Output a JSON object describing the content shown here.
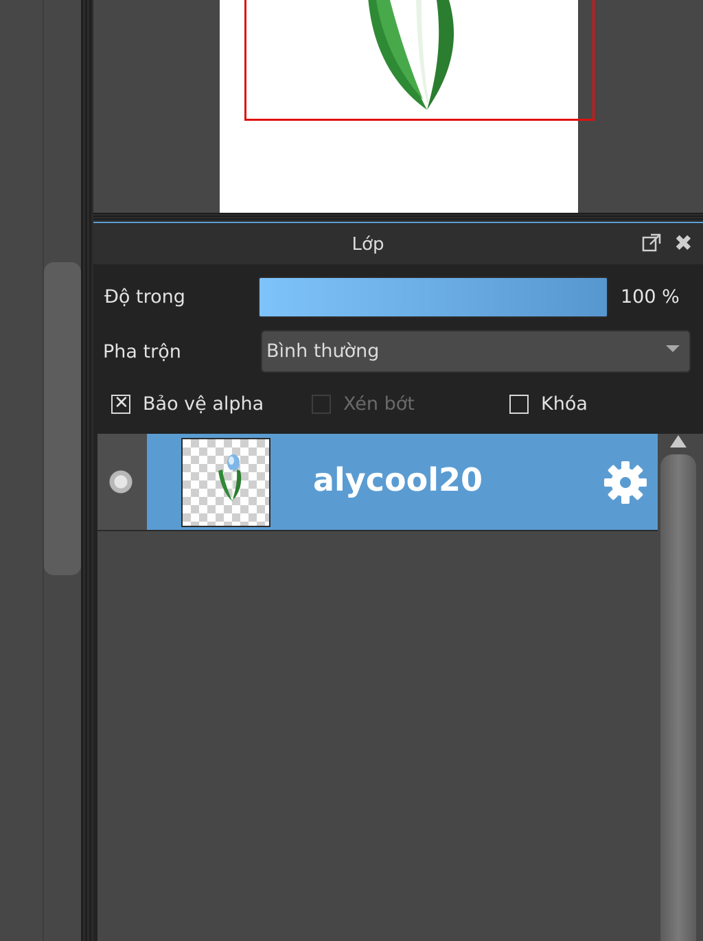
{
  "panel": {
    "title": "Lớp",
    "popout_icon": "popout-icon",
    "close_icon": "close-icon"
  },
  "opacity": {
    "label": "Độ trong",
    "value": "100 %",
    "level": 1.0
  },
  "blend": {
    "label": "Pha trộn",
    "value": "Bình thường"
  },
  "checkboxes": {
    "alpha": {
      "label": "Bảo vệ alpha",
      "checked": true
    },
    "clip": {
      "label": "Xén bớt",
      "checked": false,
      "disabled": true
    },
    "lock": {
      "label": "Khóa",
      "checked": false
    }
  },
  "layers": [
    {
      "name": "alycool20",
      "selected": true,
      "visible_icon": "visibility-dot",
      "settings_icon": "gear-icon"
    }
  ],
  "colors": {
    "selection_accent": "#5a9cd2",
    "opacity_fill": "#7fc3fb",
    "selection_rect": "#e01010"
  }
}
